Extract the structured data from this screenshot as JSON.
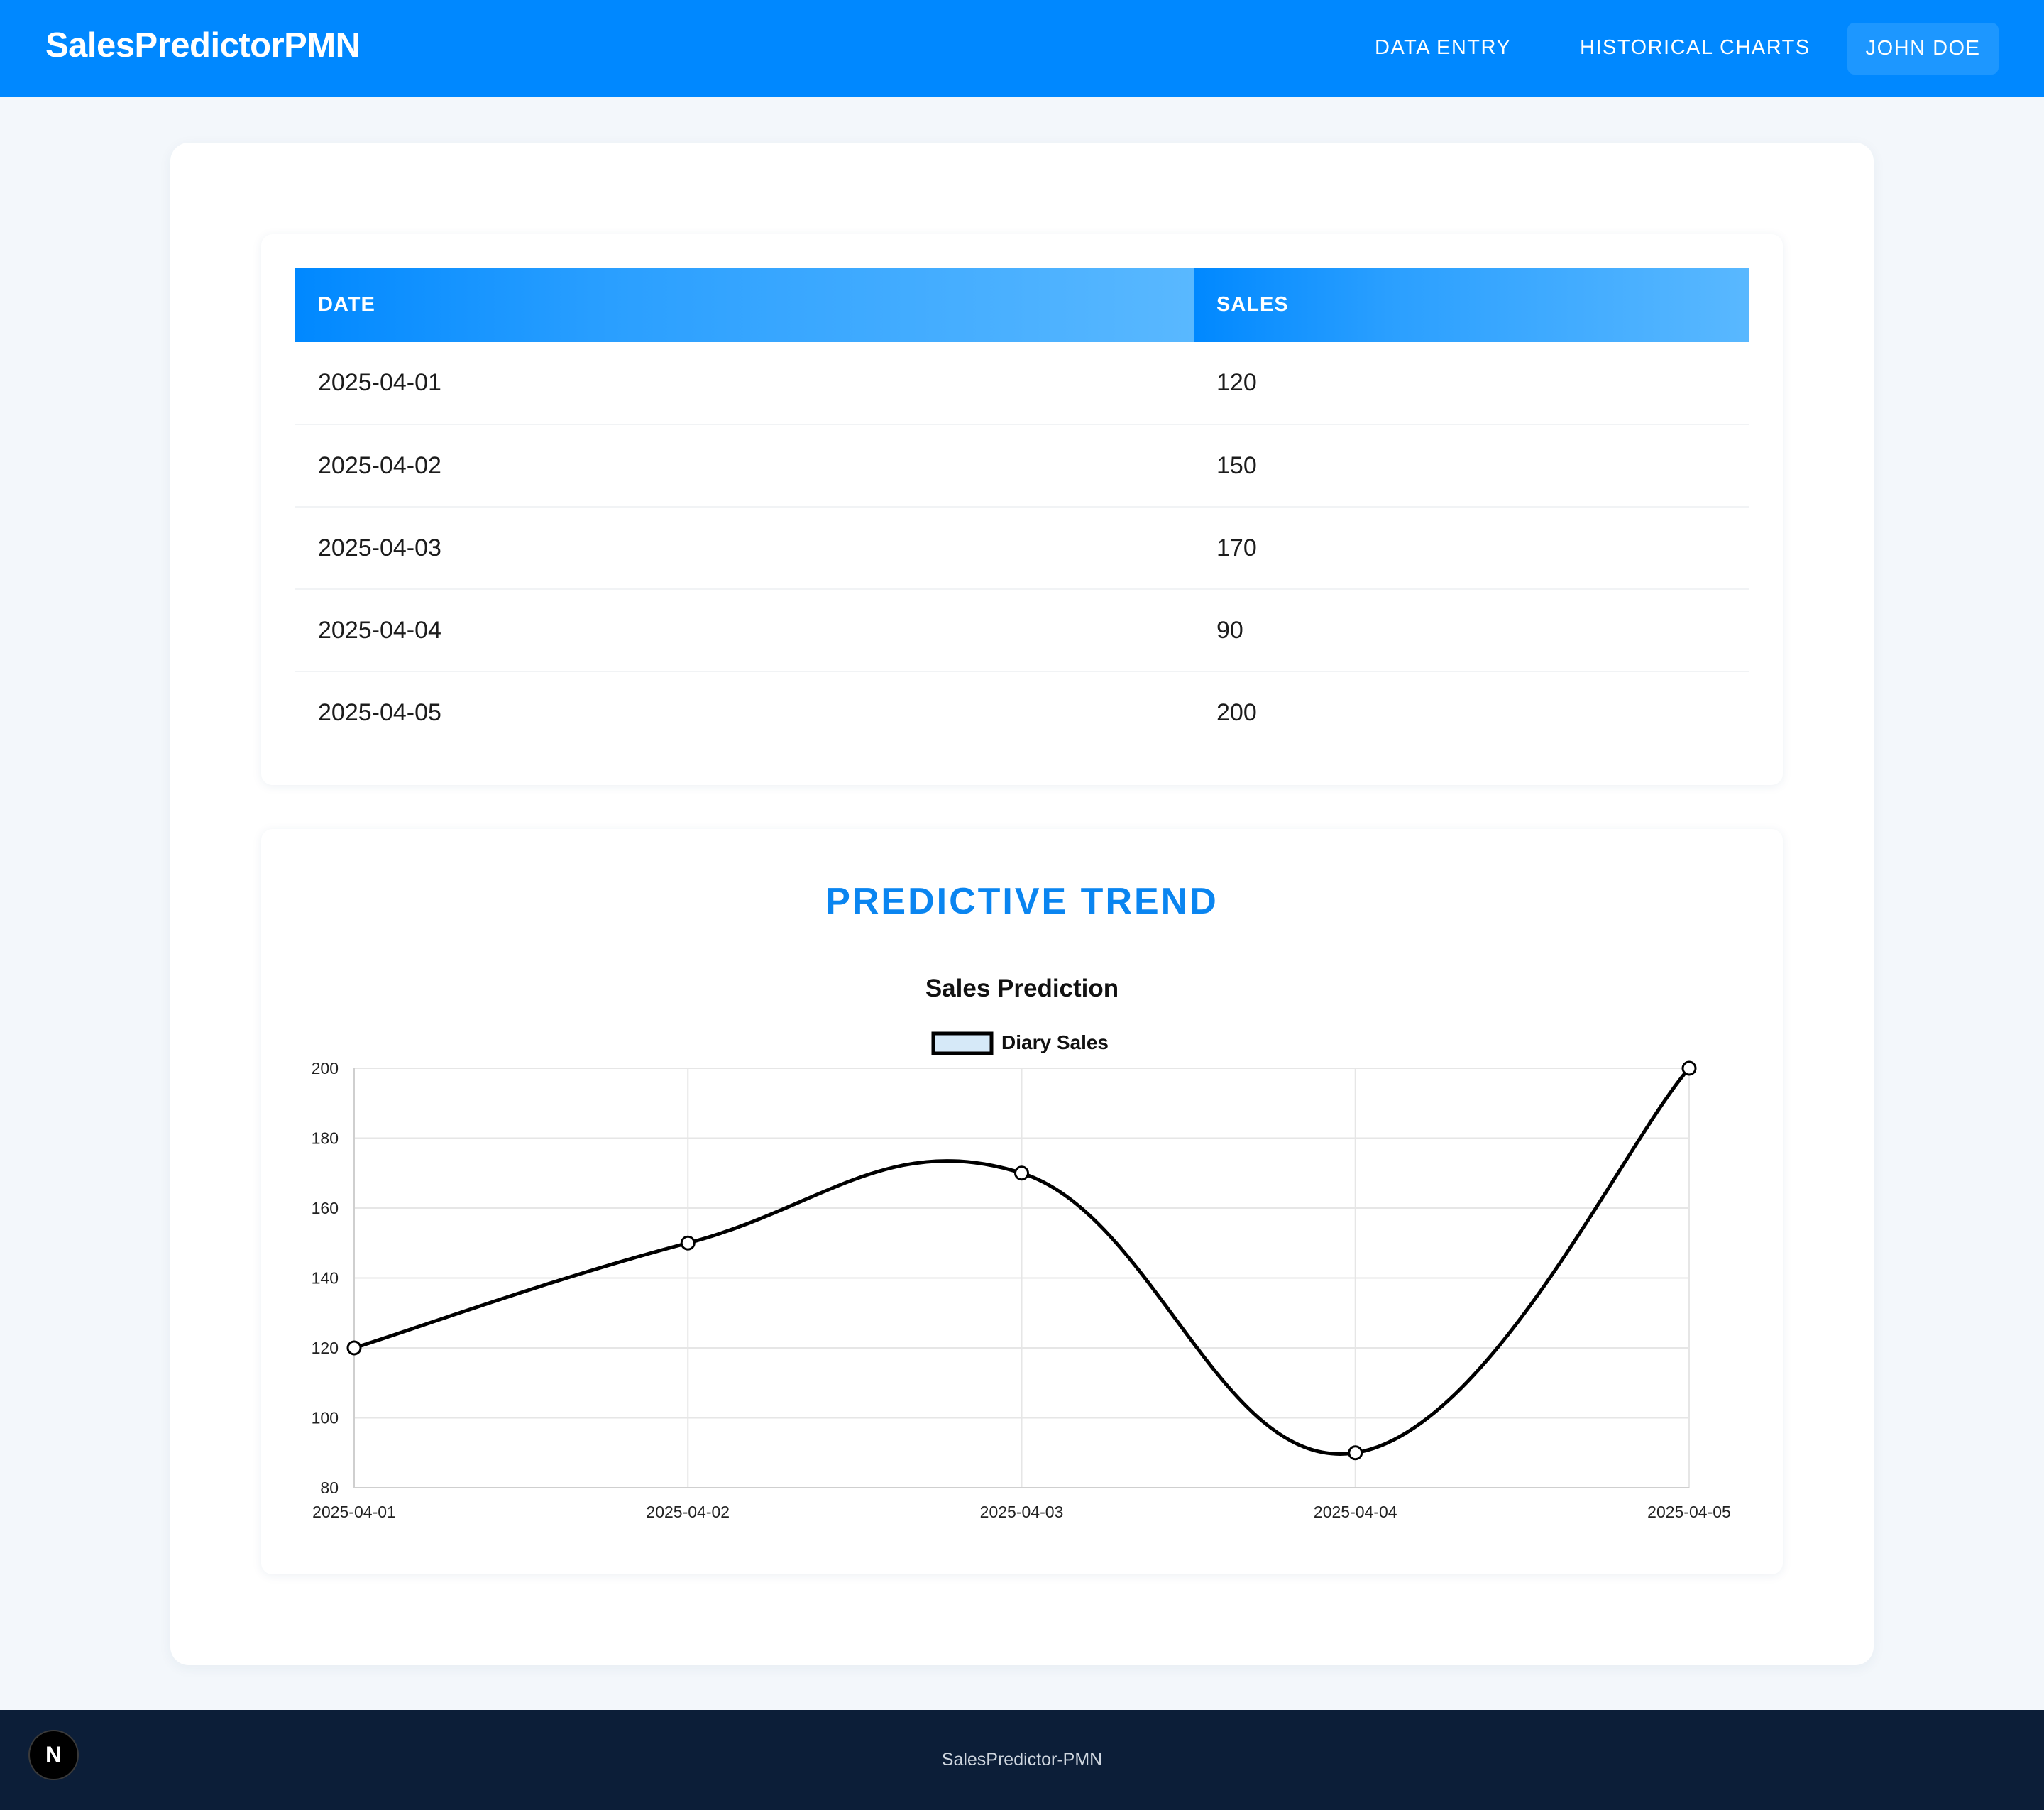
{
  "navbar": {
    "brand": "SalesPredictorPMN",
    "links": [
      "DATA ENTRY",
      "HISTORICAL CHARTS"
    ],
    "user": "JOHN DOE",
    "background": "#0088ff"
  },
  "table": {
    "headers": [
      "DATE",
      "SALES"
    ],
    "rows": [
      [
        "2025-04-01",
        "120"
      ],
      [
        "2025-04-02",
        "150"
      ],
      [
        "2025-04-03",
        "170"
      ],
      [
        "2025-04-04",
        "90"
      ],
      [
        "2025-04-05",
        "200"
      ]
    ]
  },
  "chart_section": {
    "heading": "PREDICTIVE TREND",
    "heading_color": "#0a85f0"
  },
  "chart_data": {
    "type": "line",
    "title": "Sales Prediction",
    "categories": [
      "2025-04-01",
      "2025-04-02",
      "2025-04-03",
      "2025-04-04",
      "2025-04-05"
    ],
    "series": [
      {
        "name": "Diary Sales",
        "values": [
          120,
          150,
          170,
          90,
          200
        ],
        "color": "#000000",
        "fill": "#d6e9f8"
      }
    ],
    "ylim": [
      80,
      200
    ],
    "yticks": [
      80,
      100,
      120,
      140,
      160,
      180,
      200
    ],
    "grid": true,
    "legend": "top-center",
    "xlabel": "",
    "ylabel": ""
  },
  "footer": {
    "text": "SalesPredictor-PMN",
    "badge": "N",
    "background": "#0c1e38"
  }
}
